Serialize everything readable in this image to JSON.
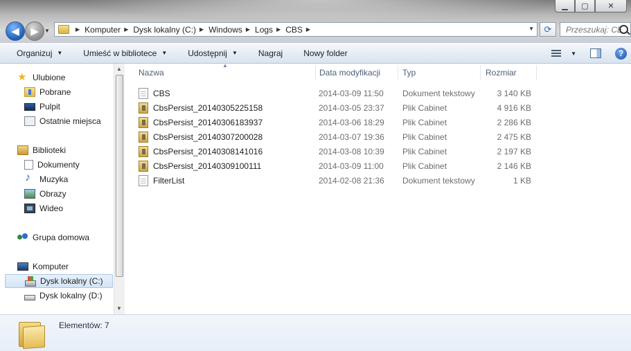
{
  "window": {
    "controls": {
      "minimize": "▁",
      "maximize": "▢",
      "close": "✕"
    }
  },
  "nav": {
    "back_glyph": "◀",
    "forward_glyph": "▶"
  },
  "address": {
    "crumbs": [
      "Komputer",
      "Dysk lokalny (C:)",
      "Windows",
      "Logs",
      "CBS"
    ]
  },
  "search": {
    "placeholder": "Przeszukaj: CBS"
  },
  "toolbar": {
    "organize": "Organizuj",
    "include_in_library": "Umieść w bibliotece",
    "share": "Udostępnij",
    "burn": "Nagraj",
    "new_folder": "Nowy folder",
    "help": "?"
  },
  "sidebar": {
    "favorites": {
      "label": "Ulubione",
      "items": [
        "Pobrane",
        "Pulpit",
        "Ostatnie miejsca"
      ]
    },
    "libraries": {
      "label": "Biblioteki",
      "items": [
        "Dokumenty",
        "Muzyka",
        "Obrazy",
        "Wideo"
      ]
    },
    "homegroup": {
      "label": "Grupa domowa"
    },
    "computer": {
      "label": "Komputer",
      "items": [
        "Dysk lokalny (C:)",
        "Dysk lokalny (D:)"
      ],
      "selected": "Dysk lokalny (C:)"
    }
  },
  "columns": {
    "name": "Nazwa",
    "date": "Data modyfikacji",
    "type": "Typ",
    "size": "Rozmiar"
  },
  "files": [
    {
      "name": "CBS",
      "date": "2014-03-09 11:50",
      "type": "Dokument tekstowy",
      "size": "3 140 KB",
      "icon": "text-file-icon"
    },
    {
      "name": "CbsPersist_20140305225158",
      "date": "2014-03-05 23:37",
      "type": "Plik Cabinet",
      "size": "4 916 KB",
      "icon": "cabinet-file-icon"
    },
    {
      "name": "CbsPersist_20140306183937",
      "date": "2014-03-06 18:29",
      "type": "Plik Cabinet",
      "size": "2 286 KB",
      "icon": "cabinet-file-icon"
    },
    {
      "name": "CbsPersist_20140307200028",
      "date": "2014-03-07 19:36",
      "type": "Plik Cabinet",
      "size": "2 475 KB",
      "icon": "cabinet-file-icon"
    },
    {
      "name": "CbsPersist_20140308141016",
      "date": "2014-03-08 10:39",
      "type": "Plik Cabinet",
      "size": "2 197 KB",
      "icon": "cabinet-file-icon"
    },
    {
      "name": "CbsPersist_20140309100111",
      "date": "2014-03-09 11:00",
      "type": "Plik Cabinet",
      "size": "2 146 KB",
      "icon": "cabinet-file-icon"
    },
    {
      "name": "FilterList",
      "date": "2014-02-08 21:36",
      "type": "Dokument tekstowy",
      "size": "1 KB",
      "icon": "text-file-icon"
    }
  ],
  "status": {
    "item_count": "Elementów: 7"
  }
}
